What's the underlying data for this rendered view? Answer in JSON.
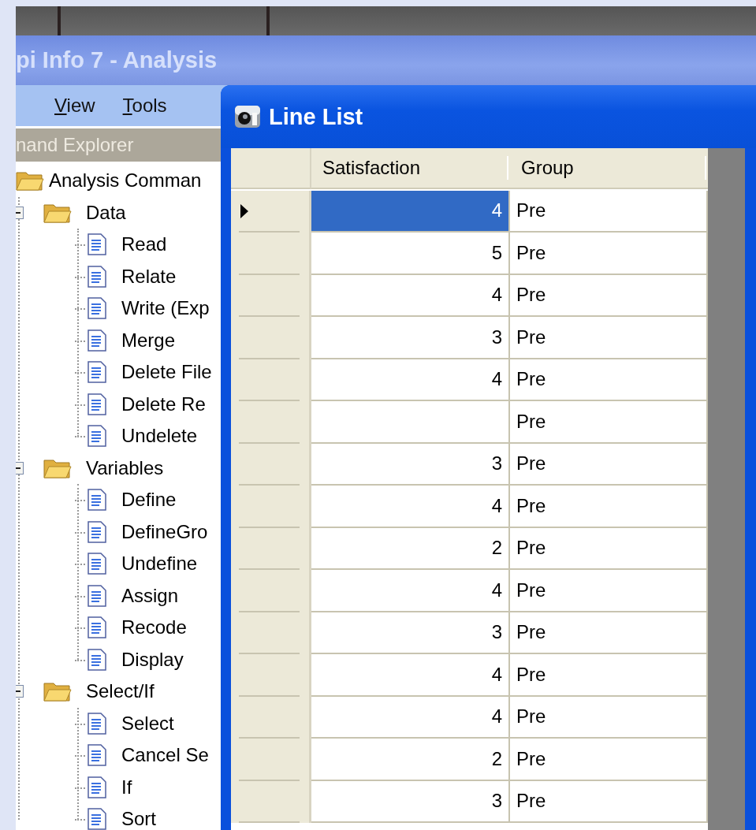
{
  "main_window": {
    "title": "pi Info 7 - Analysis",
    "menu": [
      {
        "label": "View"
      },
      {
        "label": "Tools"
      }
    ],
    "explorer": {
      "title": "nand Explorer",
      "tree": [
        {
          "label": "Analysis Comman",
          "kind": "folder",
          "expanded": true,
          "children": [
            {
              "label": "Data",
              "kind": "folder",
              "expanded": true,
              "children": [
                {
                  "label": "Read",
                  "kind": "command"
                },
                {
                  "label": "Relate",
                  "kind": "command"
                },
                {
                  "label": "Write (Exp",
                  "kind": "command"
                },
                {
                  "label": "Merge",
                  "kind": "command"
                },
                {
                  "label": "Delete File",
                  "kind": "command"
                },
                {
                  "label": "Delete Re",
                  "kind": "command"
                },
                {
                  "label": "Undelete",
                  "kind": "command"
                }
              ]
            },
            {
              "label": "Variables",
              "kind": "folder",
              "expanded": true,
              "children": [
                {
                  "label": "Define",
                  "kind": "command"
                },
                {
                  "label": "DefineGro",
                  "kind": "command"
                },
                {
                  "label": "Undefine",
                  "kind": "command"
                },
                {
                  "label": "Assign",
                  "kind": "command"
                },
                {
                  "label": "Recode",
                  "kind": "command"
                },
                {
                  "label": "Display",
                  "kind": "command"
                }
              ]
            },
            {
              "label": "Select/If",
              "kind": "folder",
              "expanded": true,
              "children": [
                {
                  "label": "Select",
                  "kind": "command"
                },
                {
                  "label": "Cancel Se",
                  "kind": "command"
                },
                {
                  "label": "If",
                  "kind": "command"
                },
                {
                  "label": "Sort",
                  "kind": "command"
                }
              ]
            }
          ]
        }
      ]
    }
  },
  "line_list": {
    "title": "Line List",
    "columns": [
      "Satisfaction",
      "Group"
    ],
    "rows": [
      {
        "satisfaction": "4",
        "group": "Pre",
        "selected": true
      },
      {
        "satisfaction": "5",
        "group": "Pre",
        "selected": false
      },
      {
        "satisfaction": "4",
        "group": "Pre",
        "selected": false
      },
      {
        "satisfaction": "3",
        "group": "Pre",
        "selected": false
      },
      {
        "satisfaction": "4",
        "group": "Pre",
        "selected": false
      },
      {
        "group": "Pre",
        "selected": false
      },
      {
        "satisfaction": "3",
        "group": "Pre",
        "selected": false
      },
      {
        "satisfaction": "4",
        "group": "Pre",
        "selected": false
      },
      {
        "satisfaction": "2",
        "group": "Pre",
        "selected": false
      },
      {
        "satisfaction": "4",
        "group": "Pre",
        "selected": false
      },
      {
        "satisfaction": "3",
        "group": "Pre",
        "selected": false
      },
      {
        "satisfaction": "4",
        "group": "Pre",
        "selected": false
      },
      {
        "satisfaction": "4",
        "group": "Pre",
        "selected": false
      },
      {
        "satisfaction": "2",
        "group": "Pre",
        "selected": false
      },
      {
        "satisfaction": "3",
        "group": "Pre",
        "selected": false
      }
    ]
  }
}
